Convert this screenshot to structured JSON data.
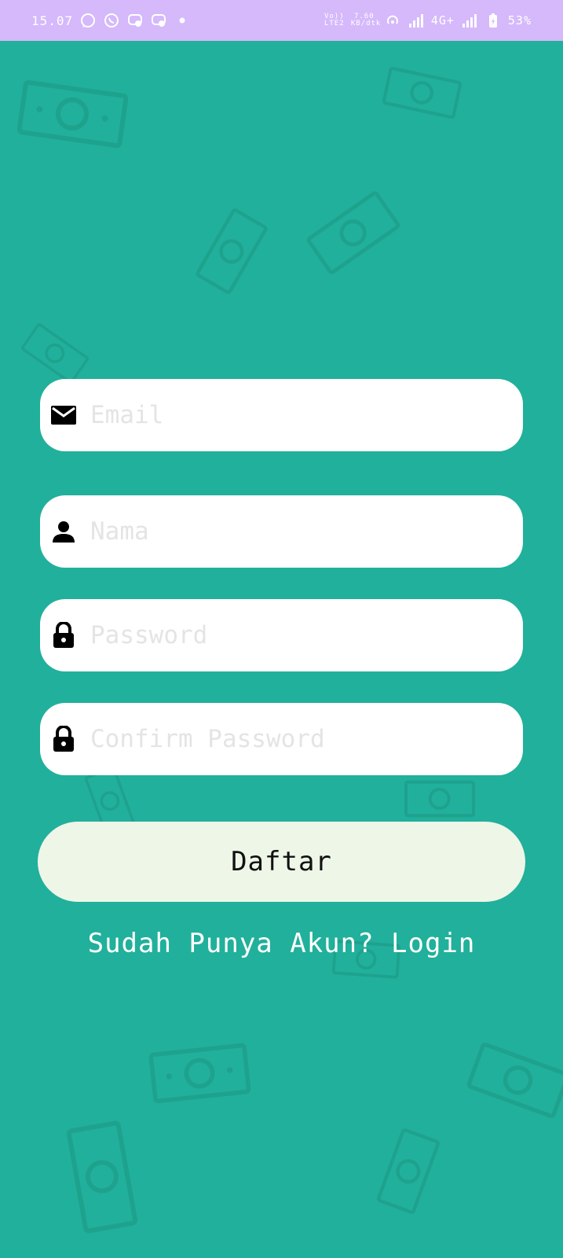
{
  "status_bar": {
    "time": "15.07",
    "indicators": [
      "whatsapp-business-icon",
      "whatsapp-icon",
      "messenger-icon",
      "messenger-icon",
      "dot"
    ],
    "volte": "Vo)) LTE2",
    "speed": "7.60 KB/dtk",
    "network": "4G+",
    "battery": "53%"
  },
  "form": {
    "email": {
      "placeholder": "Email",
      "icon": "mail-icon"
    },
    "name": {
      "placeholder": "Nama",
      "icon": "person-icon"
    },
    "password": {
      "placeholder": "Password",
      "icon": "lock-icon"
    },
    "confirm_password": {
      "placeholder": "Confirm Password",
      "icon": "lock-icon"
    },
    "submit_label": "Daftar",
    "login_link": "Sudah Punya Akun? Login"
  },
  "colors": {
    "status_bar": "#d5b9fb",
    "background": "#21b09b",
    "field": "#ffffff",
    "button": "#eef6e8"
  }
}
